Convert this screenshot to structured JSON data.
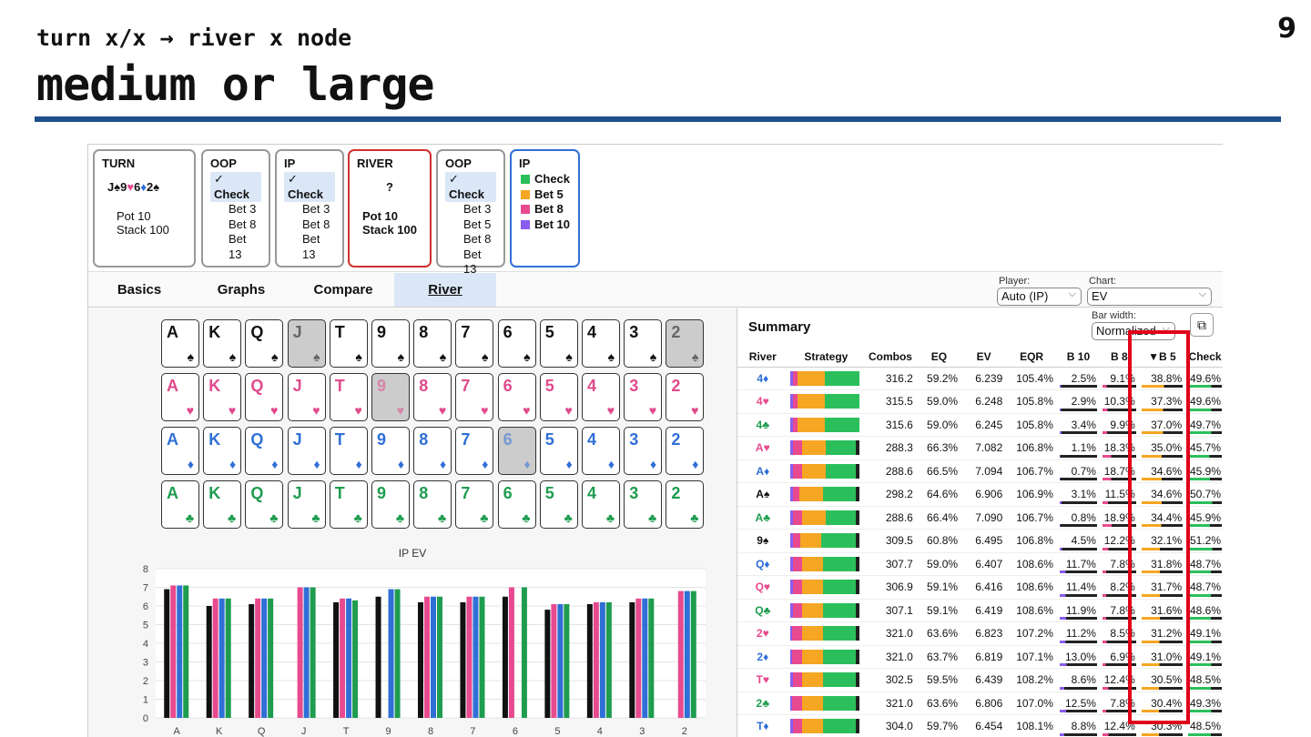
{
  "slide": {
    "subtitle": "turn x/x → river x node",
    "title": "medium or large",
    "page_number": "9"
  },
  "colors": {
    "check": "#2bbf5c",
    "bet5": "#f5a623",
    "bet8": "#e84a8f",
    "bet10": "#8a5cf0",
    "rule": "#1f4e8c",
    "oop": "#111111",
    "ip_h": "#e84a8f",
    "ip_d": "#2f6fd6",
    "ip_c": "#1e9c4f"
  },
  "nodes": [
    {
      "title": "TURN",
      "board": "J♠9♥6♦2♠",
      "pot": "Pot 10",
      "stack": "Stack 100"
    },
    {
      "title": "OOP",
      "options": [
        "Check",
        "Bet 3",
        "Bet 8",
        "Bet 13"
      ],
      "selected": 0
    },
    {
      "title": "IP",
      "options": [
        "Check",
        "Bet 3",
        "Bet 8",
        "Bet 13"
      ],
      "selected": 0
    },
    {
      "title": "RIVER",
      "board": "?",
      "pot": "Pot 10",
      "stack": "Stack 100"
    },
    {
      "title": "OOP",
      "options": [
        "Check",
        "Bet 3",
        "Bet 5",
        "Bet 8",
        "Bet 13"
      ],
      "selected": 0
    },
    {
      "title": "IP",
      "options": [
        "Check",
        "Bet 5",
        "Bet 8",
        "Bet 10"
      ],
      "colors": [
        "check",
        "bet5",
        "bet8",
        "bet10"
      ]
    }
  ],
  "tabs": [
    "Basics",
    "Graphs",
    "Compare",
    "River"
  ],
  "active_tab": "River",
  "controls": {
    "player_label": "Player:",
    "player_value": "Auto (IP)",
    "chart_label": "Chart:",
    "chart_value": "EV",
    "barwidth_label": "Bar width:",
    "barwidth_value": "Normalized"
  },
  "ranks": [
    "A",
    "K",
    "Q",
    "J",
    "T",
    "9",
    "8",
    "7",
    "6",
    "5",
    "4",
    "3",
    "2"
  ],
  "suits": [
    {
      "key": "s",
      "glyph": "♠"
    },
    {
      "key": "h",
      "glyph": "♥"
    },
    {
      "key": "d",
      "glyph": "♦"
    },
    {
      "key": "c",
      "glyph": "♣"
    }
  ],
  "dimmed": [
    "Js",
    "2s",
    "9h",
    "6d"
  ],
  "chart_data": {
    "type": "bar",
    "title": "IP EV",
    "categories": [
      "A",
      "K",
      "Q",
      "J",
      "T",
      "9",
      "8",
      "7",
      "6",
      "5",
      "4",
      "3",
      "2"
    ],
    "ylim": [
      0,
      8
    ],
    "yticks": [
      0,
      1,
      2,
      3,
      4,
      5,
      6,
      7,
      8
    ],
    "series": [
      {
        "key": "spade",
        "color": "#111111",
        "values": [
          6.9,
          6.0,
          6.1,
          null,
          6.2,
          6.5,
          6.2,
          6.2,
          6.5,
          5.8,
          6.1,
          6.2,
          null
        ]
      },
      {
        "key": "heart",
        "color": "#e84a8f",
        "values": [
          7.1,
          6.4,
          6.4,
          7.0,
          6.4,
          null,
          6.5,
          6.5,
          7.0,
          6.1,
          6.2,
          6.4,
          6.8
        ]
      },
      {
        "key": "diamond",
        "color": "#2f6fd6",
        "values": [
          7.1,
          6.4,
          6.4,
          7.0,
          6.4,
          6.9,
          6.5,
          6.5,
          null,
          6.1,
          6.2,
          6.4,
          6.8
        ]
      },
      {
        "key": "club",
        "color": "#1e9c4f",
        "values": [
          7.1,
          6.4,
          6.4,
          7.0,
          6.3,
          6.9,
          6.5,
          6.5,
          7.0,
          6.1,
          6.2,
          6.4,
          6.8
        ]
      }
    ]
  },
  "summary": {
    "title": "Summary",
    "ext_icon": "⧉",
    "headers": [
      "River",
      "Strategy",
      "Combos",
      "EQ",
      "EV",
      "EQR",
      "B 10",
      "B 8",
      "▼B 5",
      "Check"
    ],
    "rows": [
      {
        "card": "4♦",
        "suit": "d",
        "strat": [
          8,
          30,
          38
        ],
        "combos": "316.2",
        "eq": "59.2%",
        "ev": "6.239",
        "eqr": "105.4%",
        "b10": "2.5%",
        "b8": "9.1%",
        "b5": "38.8%",
        "check": "49.6%"
      },
      {
        "card": "4♥",
        "suit": "h",
        "strat": [
          8,
          30,
          38
        ],
        "combos": "315.5",
        "eq": "59.0%",
        "ev": "6.248",
        "eqr": "105.8%",
        "b10": "2.9%",
        "b8": "10.3%",
        "b5": "37.3%",
        "check": "49.6%"
      },
      {
        "card": "4♣",
        "suit": "c",
        "strat": [
          8,
          30,
          38
        ],
        "combos": "315.6",
        "eq": "59.0%",
        "ev": "6.245",
        "eqr": "105.8%",
        "b10": "3.4%",
        "b8": "9.9%",
        "b5": "37.0%",
        "check": "49.7%"
      },
      {
        "card": "A♥",
        "suit": "h",
        "strat": [
          14,
          26,
          34
        ],
        "combos": "288.3",
        "eq": "66.3%",
        "ev": "7.082",
        "eqr": "106.8%",
        "b10": "1.1%",
        "b8": "18.3%",
        "b5": "35.0%",
        "check": "45.7%"
      },
      {
        "card": "A♦",
        "suit": "d",
        "strat": [
          14,
          26,
          34
        ],
        "combos": "288.6",
        "eq": "66.5%",
        "ev": "7.094",
        "eqr": "106.7%",
        "b10": "0.7%",
        "b8": "18.7%",
        "b5": "34.6%",
        "check": "45.9%"
      },
      {
        "card": "A♠",
        "suit": "s",
        "strat": [
          11,
          26,
          36
        ],
        "combos": "298.2",
        "eq": "64.6%",
        "ev": "6.906",
        "eqr": "106.9%",
        "b10": "3.1%",
        "b8": "11.5%",
        "b5": "34.6%",
        "check": "50.7%"
      },
      {
        "card": "A♣",
        "suit": "c",
        "strat": [
          14,
          26,
          34
        ],
        "combos": "288.6",
        "eq": "66.4%",
        "ev": "7.090",
        "eqr": "106.7%",
        "b10": "0.8%",
        "b8": "18.9%",
        "b5": "34.4%",
        "check": "45.9%"
      },
      {
        "card": "9♠",
        "suit": "s",
        "strat": [
          12,
          24,
          39
        ],
        "combos": "309.5",
        "eq": "60.8%",
        "ev": "6.495",
        "eqr": "106.8%",
        "b10": "4.5%",
        "b8": "12.2%",
        "b5": "32.1%",
        "check": "51.2%"
      },
      {
        "card": "Q♦",
        "suit": "d",
        "strat": [
          14,
          24,
          37
        ],
        "combos": "307.7",
        "eq": "59.0%",
        "ev": "6.407",
        "eqr": "108.6%",
        "b10": "11.7%",
        "b8": "7.8%",
        "b5": "31.8%",
        "check": "48.7%"
      },
      {
        "card": "Q♥",
        "suit": "h",
        "strat": [
          14,
          24,
          37
        ],
        "combos": "306.9",
        "eq": "59.1%",
        "ev": "6.416",
        "eqr": "108.6%",
        "b10": "11.4%",
        "b8": "8.2%",
        "b5": "31.7%",
        "check": "48.7%"
      },
      {
        "card": "Q♣",
        "suit": "c",
        "strat": [
          14,
          24,
          37
        ],
        "combos": "307.1",
        "eq": "59.1%",
        "ev": "6.419",
        "eqr": "108.6%",
        "b10": "11.9%",
        "b8": "7.8%",
        "b5": "31.6%",
        "check": "48.6%"
      },
      {
        "card": "2♥",
        "suit": "h",
        "strat": [
          14,
          24,
          38
        ],
        "combos": "321.0",
        "eq": "63.6%",
        "ev": "6.823",
        "eqr": "107.2%",
        "b10": "11.2%",
        "b8": "8.5%",
        "b5": "31.2%",
        "check": "49.1%"
      },
      {
        "card": "2♦",
        "suit": "d",
        "strat": [
          14,
          24,
          38
        ],
        "combos": "321.0",
        "eq": "63.7%",
        "ev": "6.819",
        "eqr": "107.1%",
        "b10": "13.0%",
        "b8": "6.9%",
        "b5": "31.0%",
        "check": "49.1%"
      },
      {
        "card": "T♥",
        "suit": "h",
        "strat": [
          14,
          24,
          37
        ],
        "combos": "302.5",
        "eq": "59.5%",
        "ev": "6.439",
        "eqr": "108.2%",
        "b10": "8.6%",
        "b8": "12.4%",
        "b5": "30.5%",
        "check": "48.5%"
      },
      {
        "card": "2♣",
        "suit": "c",
        "strat": [
          14,
          24,
          38
        ],
        "combos": "321.0",
        "eq": "63.6%",
        "ev": "6.806",
        "eqr": "107.0%",
        "b10": "12.5%",
        "b8": "7.8%",
        "b5": "30.4%",
        "check": "49.3%"
      },
      {
        "card": "T♦",
        "suit": "d",
        "strat": [
          14,
          24,
          37
        ],
        "combos": "304.0",
        "eq": "59.7%",
        "ev": "6.454",
        "eqr": "108.1%",
        "b10": "8.8%",
        "b8": "12.4%",
        "b5": "30.3%",
        "check": "48.5%"
      }
    ]
  }
}
